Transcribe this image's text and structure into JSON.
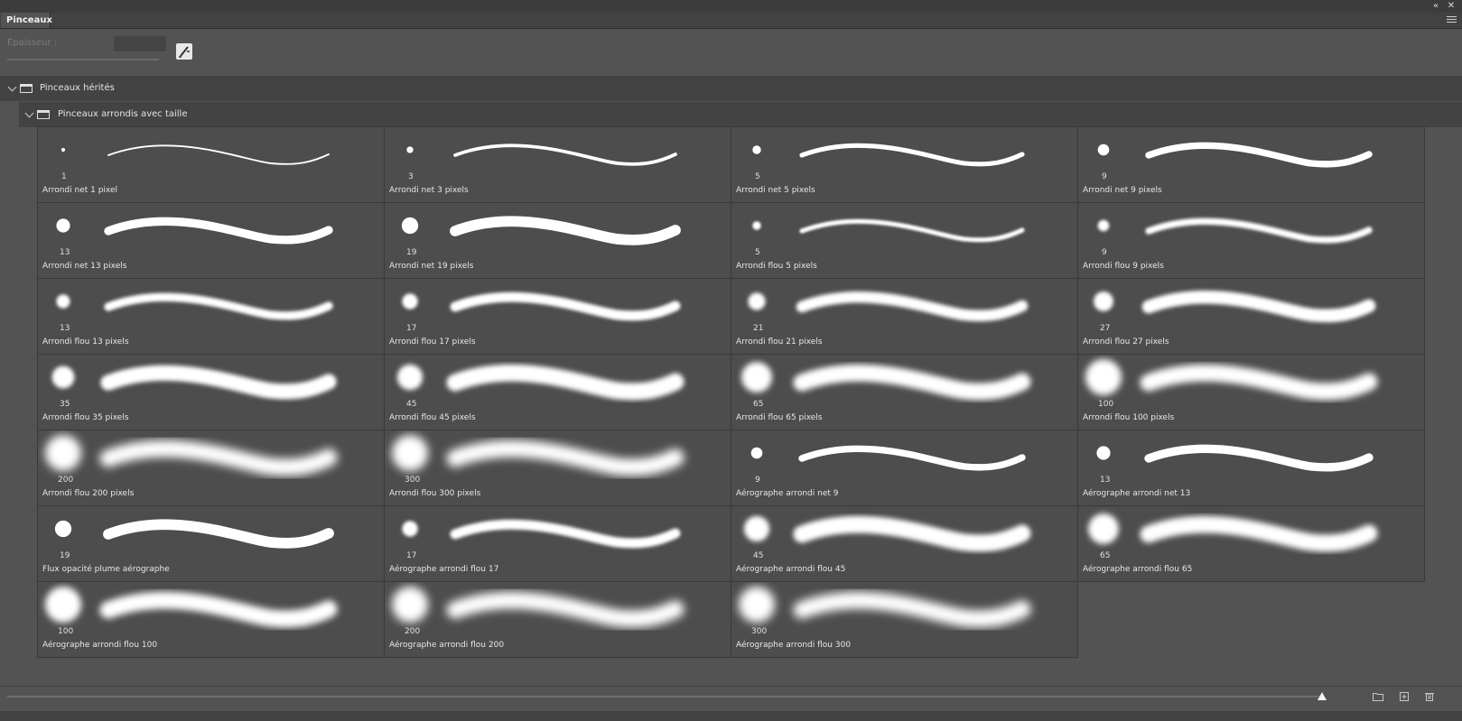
{
  "window": {
    "collapse_icon": "double-chevron-left-icon",
    "close_icon": "close-icon",
    "collapse_glyph": "«",
    "close_glyph": "✕"
  },
  "tab": {
    "label": "Pinceaux",
    "menu_icon": "hamburger-menu-icon"
  },
  "size_bar": {
    "label": "Épaisseur :",
    "value": "",
    "tool_icon": "brush-pose-icon"
  },
  "folders": [
    {
      "name": "Pinceaux hérités",
      "expanded": true
    },
    {
      "name": "Pinceaux arrondis avec taille",
      "expanded": true
    }
  ],
  "brushes": [
    {
      "size": "1",
      "name": "Arrondi net 1 pixel"
    },
    {
      "size": "3",
      "name": "Arrondi net 3 pixels"
    },
    {
      "size": "5",
      "name": "Arrondi net 5 pixels"
    },
    {
      "size": "9",
      "name": "Arrondi net 9 pixels"
    },
    {
      "size": "13",
      "name": "Arrondi net 13 pixels"
    },
    {
      "size": "19",
      "name": "Arrondi net 19 pixels"
    },
    {
      "size": "5",
      "name": "Arrondi flou 5 pixels"
    },
    {
      "size": "9",
      "name": "Arrondi flou 9 pixels"
    },
    {
      "size": "13",
      "name": "Arrondi flou 13 pixels"
    },
    {
      "size": "17",
      "name": "Arrondi flou 17 pixels"
    },
    {
      "size": "21",
      "name": "Arrondi flou 21 pixels"
    },
    {
      "size": "27",
      "name": "Arrondi flou 27 pixels"
    },
    {
      "size": "35",
      "name": "Arrondi flou 35 pixels"
    },
    {
      "size": "45",
      "name": "Arrondi flou 45 pixels"
    },
    {
      "size": "65",
      "name": "Arrondi flou 65 pixels"
    },
    {
      "size": "100",
      "name": "Arrondi flou 100 pixels"
    },
    {
      "size": "200",
      "name": "Arrondi flou 200 pixels"
    },
    {
      "size": "300",
      "name": "Arrondi flou 300 pixels"
    },
    {
      "size": "9",
      "name": "Aérographe arrondi net 9"
    },
    {
      "size": "13",
      "name": "Aérographe arrondi net 13"
    },
    {
      "size": "19",
      "name": "Flux opacité plume aérographe"
    },
    {
      "size": "17",
      "name": "Aérographe arrondi flou 17"
    },
    {
      "size": "45",
      "name": "Aérographe arrondi flou 45"
    },
    {
      "size": "65",
      "name": "Aérographe arrondi flou 65"
    },
    {
      "size": "100",
      "name": "Aérographe arrondi flou 100"
    },
    {
      "size": "200",
      "name": "Aérographe arrondi flou 200"
    },
    {
      "size": "300",
      "name": "Aérographe arrondi flou 300"
    }
  ],
  "bottom_bar": {
    "preview_size_slider": 0.97,
    "icons": [
      "new-folder-icon",
      "new-brush-icon",
      "trash-icon"
    ]
  },
  "colors": {
    "panel_bg": "#535353",
    "tile_bg": "#4d4d4d",
    "stroke": "#ffffff",
    "text": "#e8e8e8"
  }
}
